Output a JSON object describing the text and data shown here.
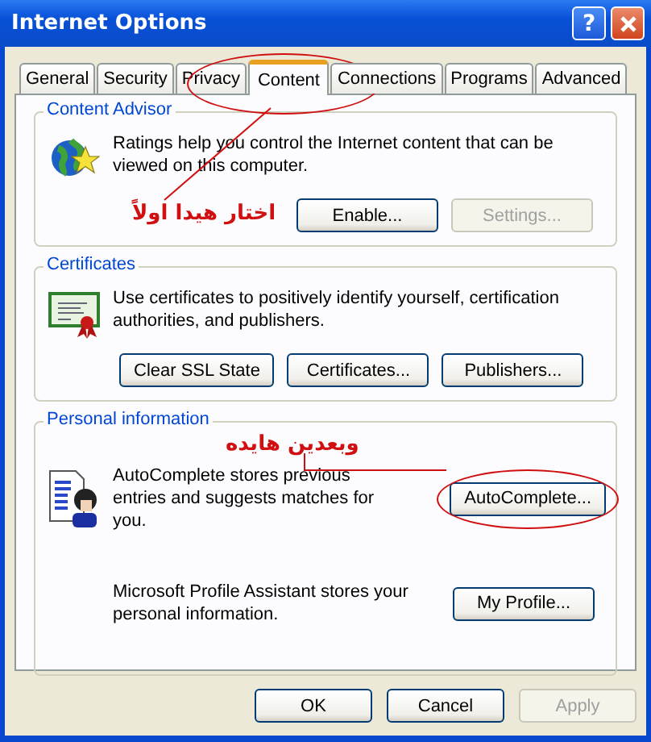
{
  "window": {
    "title": "Internet Options",
    "help_button": "?"
  },
  "tabs": [
    {
      "label": "General",
      "selected": false,
      "circled": false
    },
    {
      "label": "Security",
      "selected": false,
      "circled": false
    },
    {
      "label": "Privacy",
      "selected": false,
      "circled": false
    },
    {
      "label": "Content",
      "selected": true,
      "circled": true
    },
    {
      "label": "Connections",
      "selected": false,
      "circled": false
    },
    {
      "label": "Programs",
      "selected": false,
      "circled": false
    },
    {
      "label": "Advanced",
      "selected": false,
      "circled": false
    }
  ],
  "groups": [
    {
      "title": "Content Advisor",
      "rows": [
        {
          "kind": "stacked",
          "text": "Ratings help you control the Internet content that can be viewed on this computer.",
          "note": "اختار هيدا اولاً",
          "buttons": [
            {
              "label": "Enable...",
              "disabled": false,
              "circled": false
            },
            {
              "label": "Settings...",
              "disabled": true,
              "circled": false
            }
          ]
        }
      ]
    },
    {
      "title": "Certificates",
      "rows": [
        {
          "kind": "stacked",
          "text": "Use certificates to positively identify yourself, certification authorities, and publishers.",
          "buttons": [
            {
              "label": "Clear SSL State",
              "disabled": false,
              "circled": false
            },
            {
              "label": "Certificates...",
              "disabled": false,
              "circled": false
            },
            {
              "label": "Publishers...",
              "disabled": false,
              "circled": false
            }
          ]
        }
      ]
    },
    {
      "title": "Personal information",
      "rows": [
        {
          "kind": "side",
          "note": "وبعدين هايده",
          "text": "AutoComplete stores previous entries and suggests matches for you.",
          "buttons": [
            {
              "label": "AutoComplete...",
              "disabled": false,
              "circled": true
            }
          ]
        },
        {
          "kind": "side",
          "text": "Microsoft Profile Assistant stores your personal information.",
          "buttons": [
            {
              "label": "My Profile...",
              "disabled": false,
              "circled": false
            }
          ]
        }
      ]
    }
  ],
  "buttons": [
    {
      "label": "OK",
      "disabled": false
    },
    {
      "label": "Cancel",
      "disabled": false
    },
    {
      "label": "Apply",
      "disabled": true
    }
  ]
}
